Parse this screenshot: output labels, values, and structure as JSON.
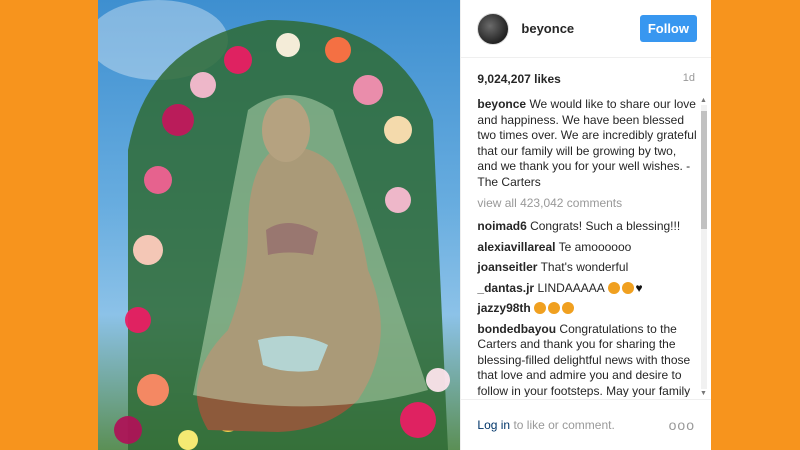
{
  "post": {
    "username": "beyonce",
    "follow_label": "Follow",
    "likes": "9,024,207 likes",
    "age": "1d",
    "caption_user": "beyonce",
    "caption_text": "We would like to share our love and happiness. We have been blessed two times over. We are incredibly grateful that our family will be growing by two, and we thank you for your well wishes. - The Carters",
    "view_all": "view all 423,042 comments"
  },
  "comments": [
    {
      "user": "noimad6",
      "text": "Congrats! Such a blessing!!!"
    },
    {
      "user": "alexiavillareal",
      "text": "Te amoooooo"
    },
    {
      "user": "joanseitler",
      "text": "That's wonderful"
    },
    {
      "user": "_dantas.jr",
      "text": "LINDAAAAA"
    },
    {
      "user": "jazzy98th",
      "text": ""
    },
    {
      "user": "bondedbayou",
      "text": "Congratulations to the Carters and thank you for sharing the blessing-filled delightful news with those that love and admire you and desire to follow in your footsteps. May your family be bonded by love now more that ever, and may your bundles of joy grow"
    }
  ],
  "footer": {
    "login_link": "Log in",
    "login_rest": " to like or comment.",
    "more": "ooo"
  },
  "icons": [
    "avatar",
    "more-options-icon",
    "scroll-up-icon",
    "scroll-down-icon",
    "emoji-icon",
    "heart-icon"
  ]
}
